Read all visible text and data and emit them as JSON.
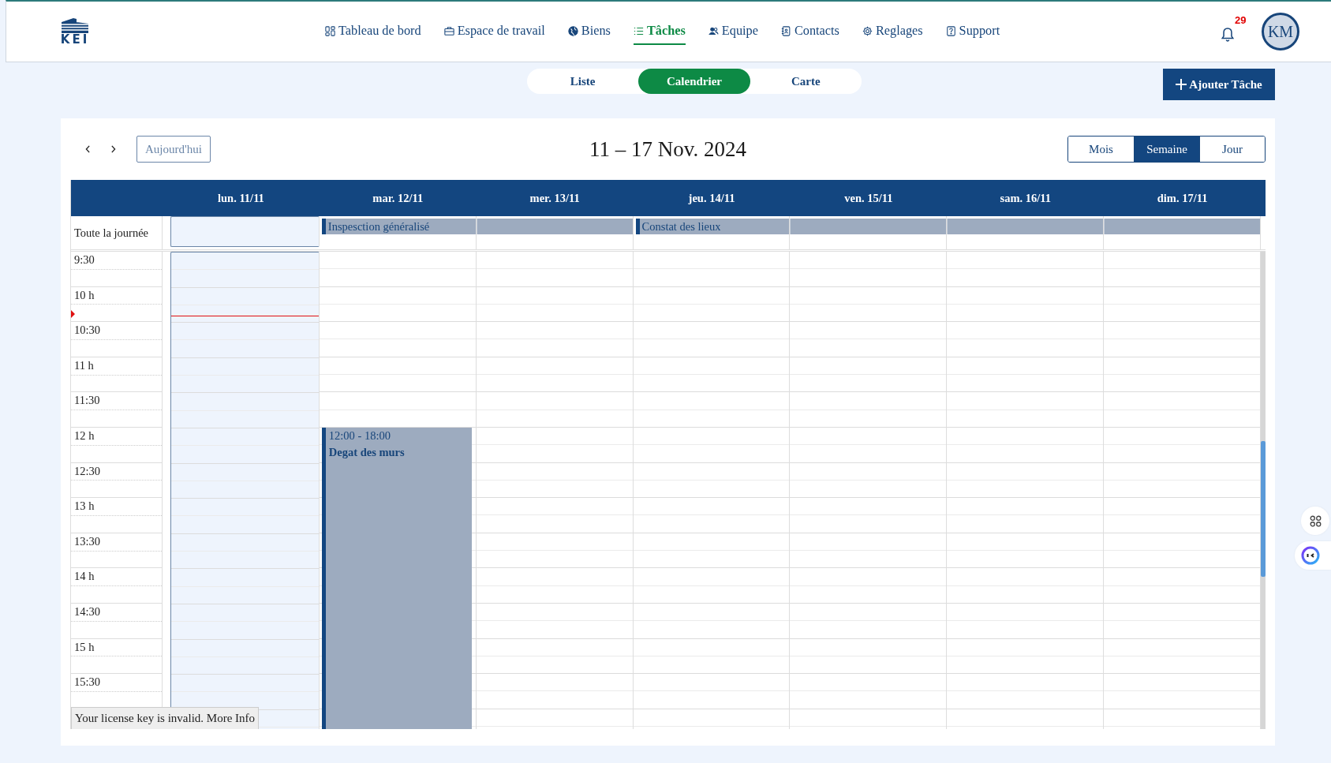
{
  "header": {
    "logo": "KEI",
    "nav": [
      {
        "label": "Tableau de bord",
        "selected": false
      },
      {
        "label": "Espace de travail",
        "selected": false
      },
      {
        "label": "Biens",
        "selected": false
      },
      {
        "label": "Tâches",
        "selected": true
      },
      {
        "label": "Equipe",
        "selected": false
      },
      {
        "label": "Contacts",
        "selected": false
      },
      {
        "label": "Reglages",
        "selected": false
      },
      {
        "label": "Support",
        "selected": false
      }
    ],
    "notifications": "29",
    "avatar": "KM"
  },
  "view_switch": [
    {
      "label": "Liste",
      "selected": false
    },
    {
      "label": "Calendrier",
      "selected": true
    },
    {
      "label": "Carte",
      "selected": false
    }
  ],
  "add_button": "Ajouter Tâche",
  "calendar": {
    "today_button": "Aujourd'hui",
    "title": "11 – 17 Nov. 2024",
    "views": [
      {
        "label": "Mois",
        "selected": false
      },
      {
        "label": "Semaine",
        "selected": true
      },
      {
        "label": "Jour",
        "selected": false
      }
    ],
    "all_day_label": "Toute la journée",
    "days": [
      {
        "label": "lun. 11/11",
        "today": true
      },
      {
        "label": "mar. 12/11",
        "today": false,
        "all_day": {
          "title": "Inspesction généralisé",
          "starts": true
        }
      },
      {
        "label": "mer. 13/11",
        "today": false,
        "all_day": {
          "starts": false
        }
      },
      {
        "label": "jeu. 14/11",
        "today": false,
        "all_day": {
          "title": "Constat des lieux",
          "starts": true
        }
      },
      {
        "label": "ven. 15/11",
        "today": false,
        "all_day": {
          "starts": false
        }
      },
      {
        "label": "sam. 16/11",
        "today": false,
        "all_day": {
          "starts": false
        }
      },
      {
        "label": "dim. 17/11",
        "today": false,
        "all_day": {
          "starts": false
        }
      }
    ],
    "time_slots": [
      {
        "label": "9:30",
        "now": false
      },
      {
        "label": "10 h",
        "now": true
      },
      {
        "label": "10:30",
        "now": false
      },
      {
        "label": "11 h",
        "now": false
      },
      {
        "label": "11:30",
        "now": false
      },
      {
        "label": "12 h",
        "now": false,
        "cells": [
          {
            "kind": "empty"
          },
          {
            "kind": "event",
            "time": "12:00 - 18:00",
            "title": "Degat des murs"
          },
          {
            "kind": "empty"
          },
          {
            "kind": "empty"
          },
          {
            "kind": "empty"
          },
          {
            "kind": "empty"
          },
          {
            "kind": "empty"
          }
        ]
      },
      {
        "label": "12:30",
        "now": false
      },
      {
        "label": "13 h",
        "now": false
      },
      {
        "label": "13:30",
        "now": false
      },
      {
        "label": "14 h",
        "now": false
      },
      {
        "label": "14:30",
        "now": false
      },
      {
        "label": "15 h",
        "now": false
      },
      {
        "label": "15:30",
        "now": false
      }
    ],
    "license_notice": {
      "text": "Your license key is invalid.",
      "link": "More Info"
    }
  }
}
